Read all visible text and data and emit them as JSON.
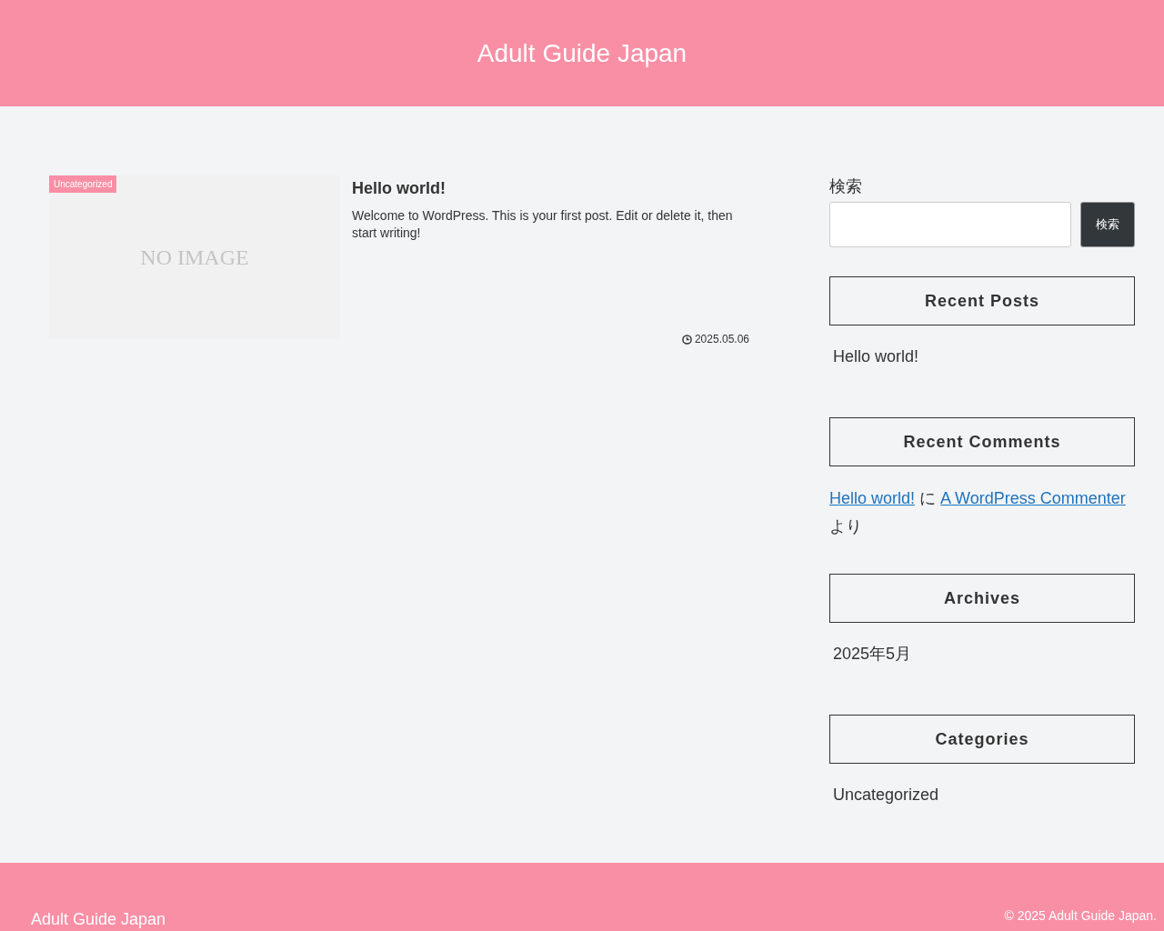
{
  "header": {
    "site_title": "Adult Guide Japan"
  },
  "posts": [
    {
      "category": "Uncategorized",
      "thumbnail_text": "NO IMAGE",
      "title": "Hello world!",
      "excerpt": "Welcome to WordPress. This is your first post. Edit or delete it, then start writing!",
      "date": "2025.05.06"
    }
  ],
  "sidebar": {
    "search": {
      "label": "検索",
      "button": "検索"
    },
    "widgets": [
      {
        "kind": "list",
        "title": "Recent Posts",
        "items": [
          "Hello world!"
        ]
      },
      {
        "kind": "comments",
        "title": "Recent Comments",
        "comments": [
          {
            "post": "Hello world!",
            "joiner": "に",
            "author": "A WordPress Commenter",
            "suffix": "より"
          }
        ]
      },
      {
        "kind": "list",
        "title": "Archives",
        "items": [
          "2025年5月"
        ]
      },
      {
        "kind": "list",
        "title": "Categories",
        "items": [
          "Uncategorized"
        ]
      }
    ]
  },
  "footer": {
    "site_name": "Adult Guide Japan",
    "copyright": "© 2025 Adult Guide Japan."
  }
}
